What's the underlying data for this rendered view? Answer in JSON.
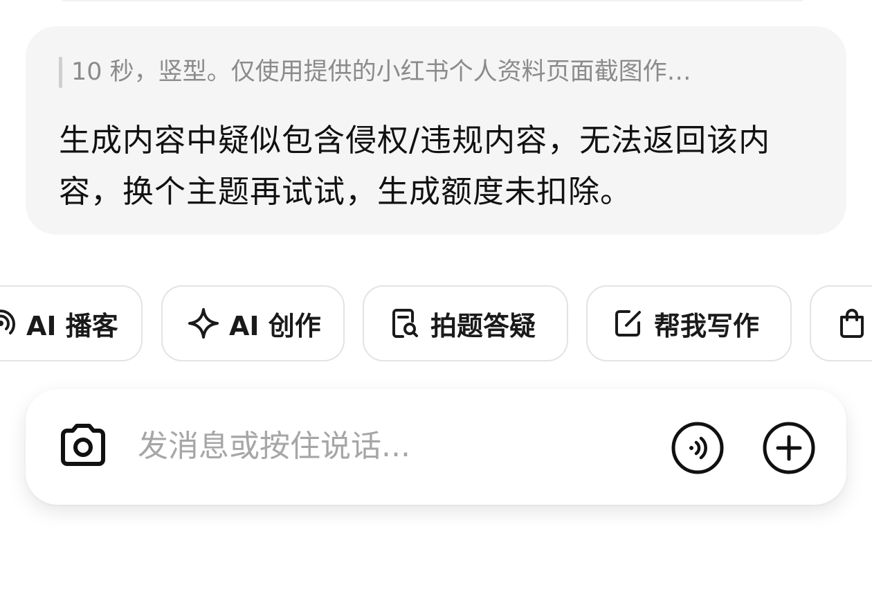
{
  "message": {
    "quote": "10 秒，竖型。仅使用提供的小红书个人资料页面截图作…",
    "reply": "生成内容中疑似包含侵权/违规内容，无法返回该内容，换个主题再试试，生成额度未扣除。"
  },
  "chips": [
    {
      "label": "AI 播客",
      "icon": "podcast-icon"
    },
    {
      "label": "AI 创作",
      "icon": "sparkle-icon"
    },
    {
      "label": "拍题答疑",
      "icon": "doc-search-icon"
    },
    {
      "label": "帮我写作",
      "icon": "edit-icon"
    },
    {
      "label": "",
      "icon": "shopping-bag-icon"
    }
  ],
  "input": {
    "placeholder": "发消息或按住说话...",
    "camera_icon": "camera-icon",
    "voice_icon": "voice-icon",
    "plus_icon": "plus-circle-icon"
  }
}
